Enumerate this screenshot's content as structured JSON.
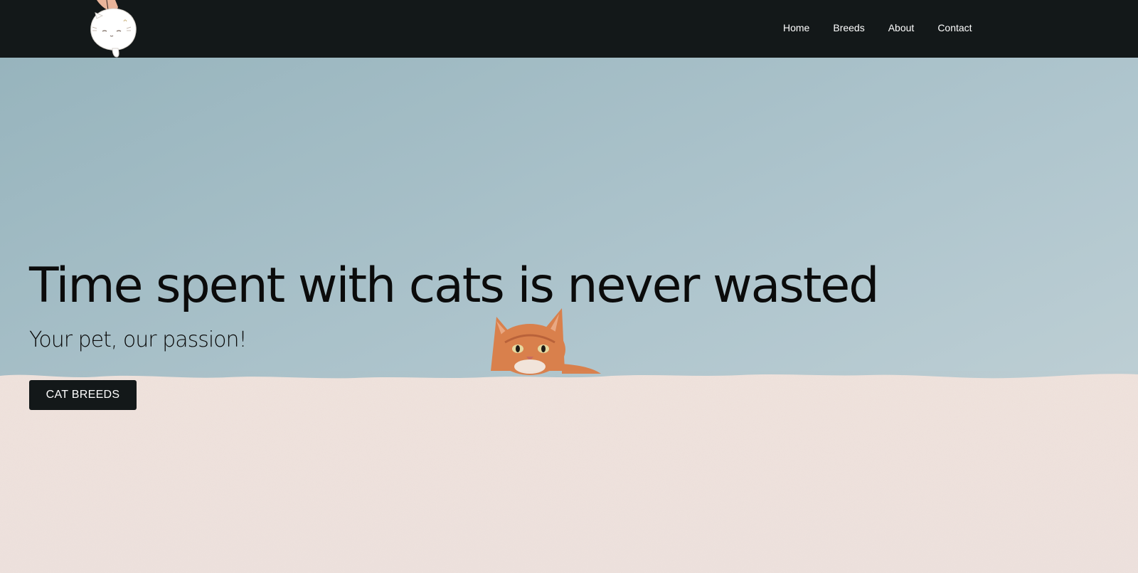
{
  "nav": {
    "logo_icon": "cat-mascot-logo",
    "links": [
      {
        "label": "Home"
      },
      {
        "label": "Breeds"
      },
      {
        "label": "About"
      },
      {
        "label": "Contact"
      }
    ]
  },
  "hero": {
    "headline": "Time spent with cats is never wasted",
    "subheadline": "Your pet, our passion!",
    "cta_label": "CAT BREEDS",
    "image_icon": "cat-peeking-over-wall-photo"
  },
  "colors": {
    "navbar_bg": "#131819",
    "button_bg": "#131819",
    "sky": "#aac2ca",
    "wall": "#efe3df",
    "cat": "#d9804c"
  }
}
